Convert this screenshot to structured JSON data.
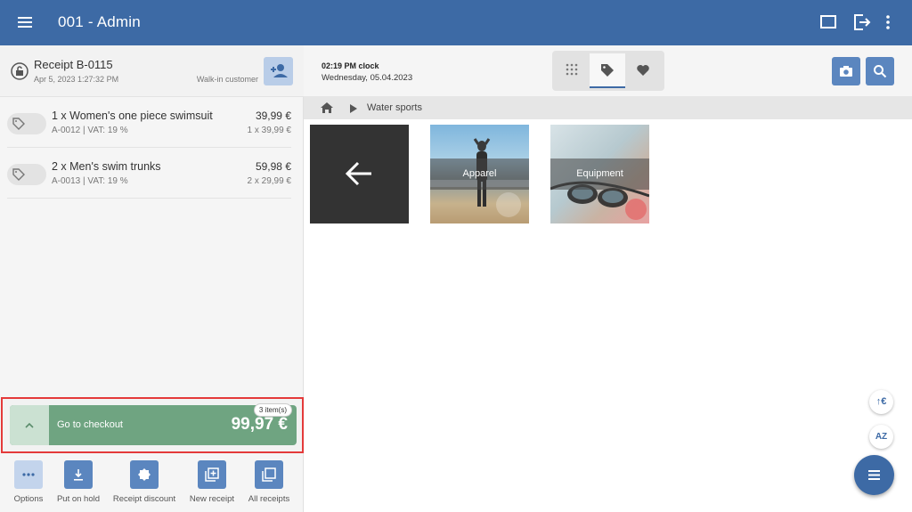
{
  "header": {
    "title": "001 - Admin",
    "icons": [
      "menu-icon",
      "window-icon",
      "logout-icon",
      "more-vert-icon"
    ]
  },
  "receipt": {
    "number": "Receipt B-0115",
    "date": "Apr 5, 2023 1:27:32 PM",
    "customer": "Walk-in customer"
  },
  "items": [
    {
      "name": "1 x Women's one piece swimsuit",
      "meta": "A-0012 | VAT: 19 %",
      "total": "39,99 €",
      "unit": "1 x 39,99 €"
    },
    {
      "name": "2 x Men's swim trunks",
      "meta": "A-0013 | VAT: 19 %",
      "total": "59,98 €",
      "unit": "2 x 29,99 €"
    }
  ],
  "checkout": {
    "label": "Go to checkout",
    "amount": "99,97 €",
    "badge": "3 item(s)"
  },
  "actions": [
    {
      "label": "Options",
      "icon": "more-horiz-icon"
    },
    {
      "label": "Put on hold",
      "icon": "download-icon"
    },
    {
      "label": "Receipt discount",
      "icon": "discount-icon"
    },
    {
      "label": "New receipt",
      "icon": "add-box-icon"
    },
    {
      "label": "All receipts",
      "icon": "copy-icon"
    }
  ],
  "toolbar": {
    "clock": "02:19 PM clock",
    "date": "Wednesday,  05.04.2023",
    "segments": [
      "dialpad-icon",
      "tag-icon",
      "heart-icon"
    ],
    "active_segment": "tag-icon"
  },
  "breadcrumb": {
    "current": "Water sports"
  },
  "tiles": [
    {
      "label": "Apparel"
    },
    {
      "label": "Equipment"
    }
  ],
  "side_buttons": {
    "currency": "€",
    "sort": "AZ"
  },
  "colors": {
    "primary": "#3d6aa5",
    "checkout": "#6fa481",
    "highlight": "#e43a3a"
  }
}
